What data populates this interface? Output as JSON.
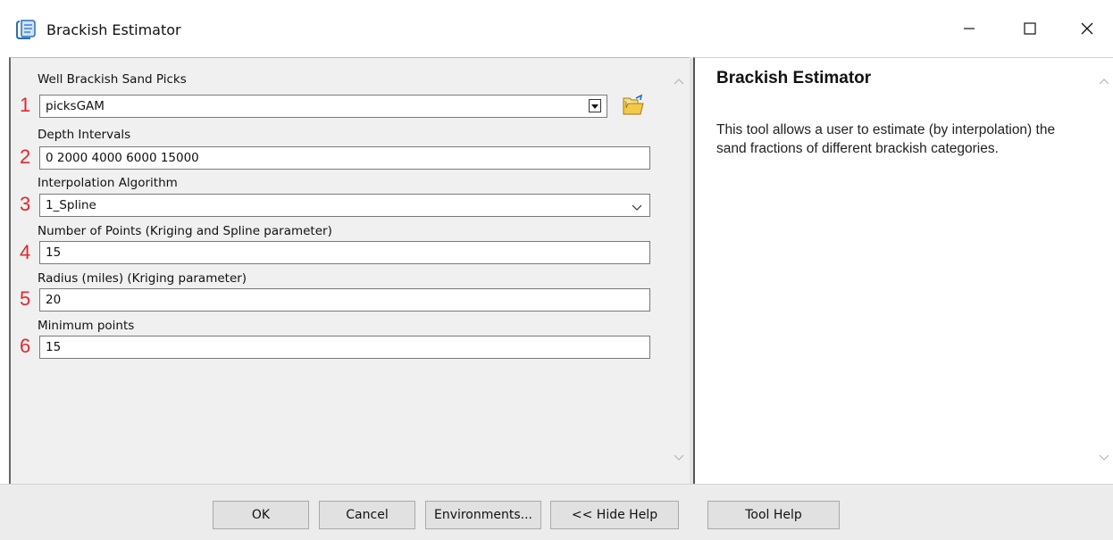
{
  "window": {
    "title": "Brackish Estimator",
    "app_icon": "scroll-tool-icon",
    "controls": [
      "minimize-icon",
      "maximize-icon",
      "close-icon"
    ]
  },
  "form": {
    "fields": [
      {
        "number": "1",
        "label": "Well Brackish Sand Picks",
        "value": "picksGAM",
        "type": "combo-with-browse"
      },
      {
        "number": "2",
        "label": "Depth Intervals",
        "value": "0 2000 4000 6000 15000",
        "type": "text"
      },
      {
        "number": "3",
        "label": "Interpolation Algorithm",
        "value": "1_Spline",
        "type": "dropdown"
      },
      {
        "number": "4",
        "label": "Number of Points (Kriging and Spline parameter)",
        "value": "15",
        "type": "text"
      },
      {
        "number": "5",
        "label": "Radius (miles) (Kriging parameter)",
        "value": "20",
        "type": "text"
      },
      {
        "number": "6",
        "label": "Minimum points",
        "value": "15",
        "type": "text"
      }
    ]
  },
  "help": {
    "title": "Brackish Estimator",
    "body": "This tool allows a user to estimate (by interpolation) the sand fractions of different brackish categories."
  },
  "buttons": {
    "ok": "OK",
    "cancel": "Cancel",
    "environments": "Environments...",
    "hide_help": "<< Hide Help",
    "tool_help": "Tool Help"
  },
  "colors": {
    "number_marker": "#e3262d",
    "dialog_background": "#f0f0f0",
    "help_background": "#ffffff"
  }
}
